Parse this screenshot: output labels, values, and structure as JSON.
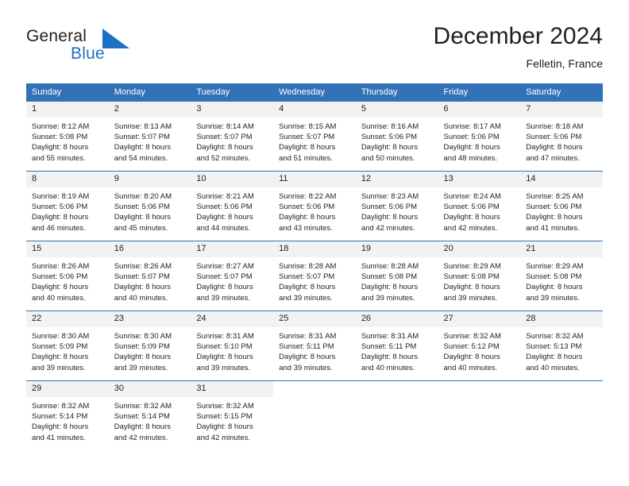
{
  "brand": {
    "name_part1": "General",
    "name_part2": "Blue",
    "mark_icon": "triangle-logo-icon",
    "color_primary": "#1f6fc4",
    "color_text": "#231f20"
  },
  "header": {
    "title": "December 2024",
    "subtitle": "Felletin, France",
    "header_bg": "#3273b7",
    "row_divider": "#3273b7",
    "daynum_bg": "#f2f2f2"
  },
  "weekdays": [
    "Sunday",
    "Monday",
    "Tuesday",
    "Wednesday",
    "Thursday",
    "Friday",
    "Saturday"
  ],
  "weeks": [
    [
      {
        "day": "1",
        "sunrise": "Sunrise: 8:12 AM",
        "sunset": "Sunset: 5:08 PM",
        "daylight1": "Daylight: 8 hours",
        "daylight2": "and 55 minutes."
      },
      {
        "day": "2",
        "sunrise": "Sunrise: 8:13 AM",
        "sunset": "Sunset: 5:07 PM",
        "daylight1": "Daylight: 8 hours",
        "daylight2": "and 54 minutes."
      },
      {
        "day": "3",
        "sunrise": "Sunrise: 8:14 AM",
        "sunset": "Sunset: 5:07 PM",
        "daylight1": "Daylight: 8 hours",
        "daylight2": "and 52 minutes."
      },
      {
        "day": "4",
        "sunrise": "Sunrise: 8:15 AM",
        "sunset": "Sunset: 5:07 PM",
        "daylight1": "Daylight: 8 hours",
        "daylight2": "and 51 minutes."
      },
      {
        "day": "5",
        "sunrise": "Sunrise: 8:16 AM",
        "sunset": "Sunset: 5:06 PM",
        "daylight1": "Daylight: 8 hours",
        "daylight2": "and 50 minutes."
      },
      {
        "day": "6",
        "sunrise": "Sunrise: 8:17 AM",
        "sunset": "Sunset: 5:06 PM",
        "daylight1": "Daylight: 8 hours",
        "daylight2": "and 48 minutes."
      },
      {
        "day": "7",
        "sunrise": "Sunrise: 8:18 AM",
        "sunset": "Sunset: 5:06 PM",
        "daylight1": "Daylight: 8 hours",
        "daylight2": "and 47 minutes."
      }
    ],
    [
      {
        "day": "8",
        "sunrise": "Sunrise: 8:19 AM",
        "sunset": "Sunset: 5:06 PM",
        "daylight1": "Daylight: 8 hours",
        "daylight2": "and 46 minutes."
      },
      {
        "day": "9",
        "sunrise": "Sunrise: 8:20 AM",
        "sunset": "Sunset: 5:06 PM",
        "daylight1": "Daylight: 8 hours",
        "daylight2": "and 45 minutes."
      },
      {
        "day": "10",
        "sunrise": "Sunrise: 8:21 AM",
        "sunset": "Sunset: 5:06 PM",
        "daylight1": "Daylight: 8 hours",
        "daylight2": "and 44 minutes."
      },
      {
        "day": "11",
        "sunrise": "Sunrise: 8:22 AM",
        "sunset": "Sunset: 5:06 PM",
        "daylight1": "Daylight: 8 hours",
        "daylight2": "and 43 minutes."
      },
      {
        "day": "12",
        "sunrise": "Sunrise: 8:23 AM",
        "sunset": "Sunset: 5:06 PM",
        "daylight1": "Daylight: 8 hours",
        "daylight2": "and 42 minutes."
      },
      {
        "day": "13",
        "sunrise": "Sunrise: 8:24 AM",
        "sunset": "Sunset: 5:06 PM",
        "daylight1": "Daylight: 8 hours",
        "daylight2": "and 42 minutes."
      },
      {
        "day": "14",
        "sunrise": "Sunrise: 8:25 AM",
        "sunset": "Sunset: 5:06 PM",
        "daylight1": "Daylight: 8 hours",
        "daylight2": "and 41 minutes."
      }
    ],
    [
      {
        "day": "15",
        "sunrise": "Sunrise: 8:26 AM",
        "sunset": "Sunset: 5:06 PM",
        "daylight1": "Daylight: 8 hours",
        "daylight2": "and 40 minutes."
      },
      {
        "day": "16",
        "sunrise": "Sunrise: 8:26 AM",
        "sunset": "Sunset: 5:07 PM",
        "daylight1": "Daylight: 8 hours",
        "daylight2": "and 40 minutes."
      },
      {
        "day": "17",
        "sunrise": "Sunrise: 8:27 AM",
        "sunset": "Sunset: 5:07 PM",
        "daylight1": "Daylight: 8 hours",
        "daylight2": "and 39 minutes."
      },
      {
        "day": "18",
        "sunrise": "Sunrise: 8:28 AM",
        "sunset": "Sunset: 5:07 PM",
        "daylight1": "Daylight: 8 hours",
        "daylight2": "and 39 minutes."
      },
      {
        "day": "19",
        "sunrise": "Sunrise: 8:28 AM",
        "sunset": "Sunset: 5:08 PM",
        "daylight1": "Daylight: 8 hours",
        "daylight2": "and 39 minutes."
      },
      {
        "day": "20",
        "sunrise": "Sunrise: 8:29 AM",
        "sunset": "Sunset: 5:08 PM",
        "daylight1": "Daylight: 8 hours",
        "daylight2": "and 39 minutes."
      },
      {
        "day": "21",
        "sunrise": "Sunrise: 8:29 AM",
        "sunset": "Sunset: 5:08 PM",
        "daylight1": "Daylight: 8 hours",
        "daylight2": "and 39 minutes."
      }
    ],
    [
      {
        "day": "22",
        "sunrise": "Sunrise: 8:30 AM",
        "sunset": "Sunset: 5:09 PM",
        "daylight1": "Daylight: 8 hours",
        "daylight2": "and 39 minutes."
      },
      {
        "day": "23",
        "sunrise": "Sunrise: 8:30 AM",
        "sunset": "Sunset: 5:09 PM",
        "daylight1": "Daylight: 8 hours",
        "daylight2": "and 39 minutes."
      },
      {
        "day": "24",
        "sunrise": "Sunrise: 8:31 AM",
        "sunset": "Sunset: 5:10 PM",
        "daylight1": "Daylight: 8 hours",
        "daylight2": "and 39 minutes."
      },
      {
        "day": "25",
        "sunrise": "Sunrise: 8:31 AM",
        "sunset": "Sunset: 5:11 PM",
        "daylight1": "Daylight: 8 hours",
        "daylight2": "and 39 minutes."
      },
      {
        "day": "26",
        "sunrise": "Sunrise: 8:31 AM",
        "sunset": "Sunset: 5:11 PM",
        "daylight1": "Daylight: 8 hours",
        "daylight2": "and 40 minutes."
      },
      {
        "day": "27",
        "sunrise": "Sunrise: 8:32 AM",
        "sunset": "Sunset: 5:12 PM",
        "daylight1": "Daylight: 8 hours",
        "daylight2": "and 40 minutes."
      },
      {
        "day": "28",
        "sunrise": "Sunrise: 8:32 AM",
        "sunset": "Sunset: 5:13 PM",
        "daylight1": "Daylight: 8 hours",
        "daylight2": "and 40 minutes."
      }
    ],
    [
      {
        "day": "29",
        "sunrise": "Sunrise: 8:32 AM",
        "sunset": "Sunset: 5:14 PM",
        "daylight1": "Daylight: 8 hours",
        "daylight2": "and 41 minutes."
      },
      {
        "day": "30",
        "sunrise": "Sunrise: 8:32 AM",
        "sunset": "Sunset: 5:14 PM",
        "daylight1": "Daylight: 8 hours",
        "daylight2": "and 42 minutes."
      },
      {
        "day": "31",
        "sunrise": "Sunrise: 8:32 AM",
        "sunset": "Sunset: 5:15 PM",
        "daylight1": "Daylight: 8 hours",
        "daylight2": "and 42 minutes."
      },
      {
        "day": "",
        "sunrise": "",
        "sunset": "",
        "daylight1": "",
        "daylight2": ""
      },
      {
        "day": "",
        "sunrise": "",
        "sunset": "",
        "daylight1": "",
        "daylight2": ""
      },
      {
        "day": "",
        "sunrise": "",
        "sunset": "",
        "daylight1": "",
        "daylight2": ""
      },
      {
        "day": "",
        "sunrise": "",
        "sunset": "",
        "daylight1": "",
        "daylight2": ""
      }
    ]
  ]
}
